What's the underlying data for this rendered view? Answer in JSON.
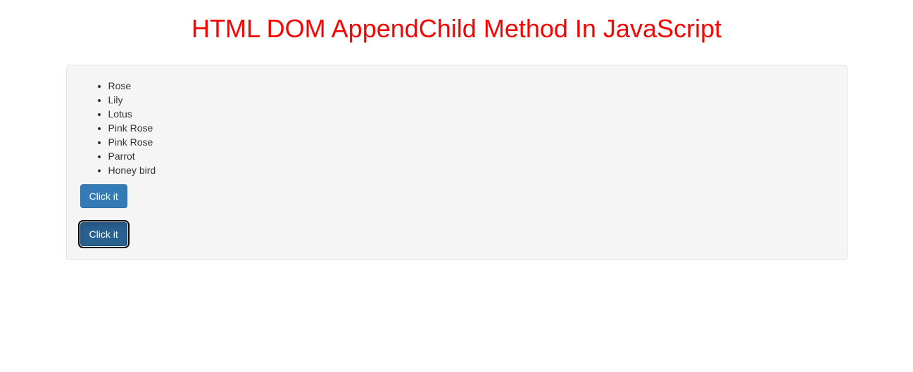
{
  "heading": "HTML DOM AppendChild Method In JavaScript",
  "list": {
    "items": [
      "Rose",
      "Lily",
      "Lotus",
      "Pink Rose",
      "Pink Rose",
      "Parrot",
      "Honey bird"
    ]
  },
  "buttons": {
    "btn1": "Click it",
    "btn2": "Click it"
  }
}
